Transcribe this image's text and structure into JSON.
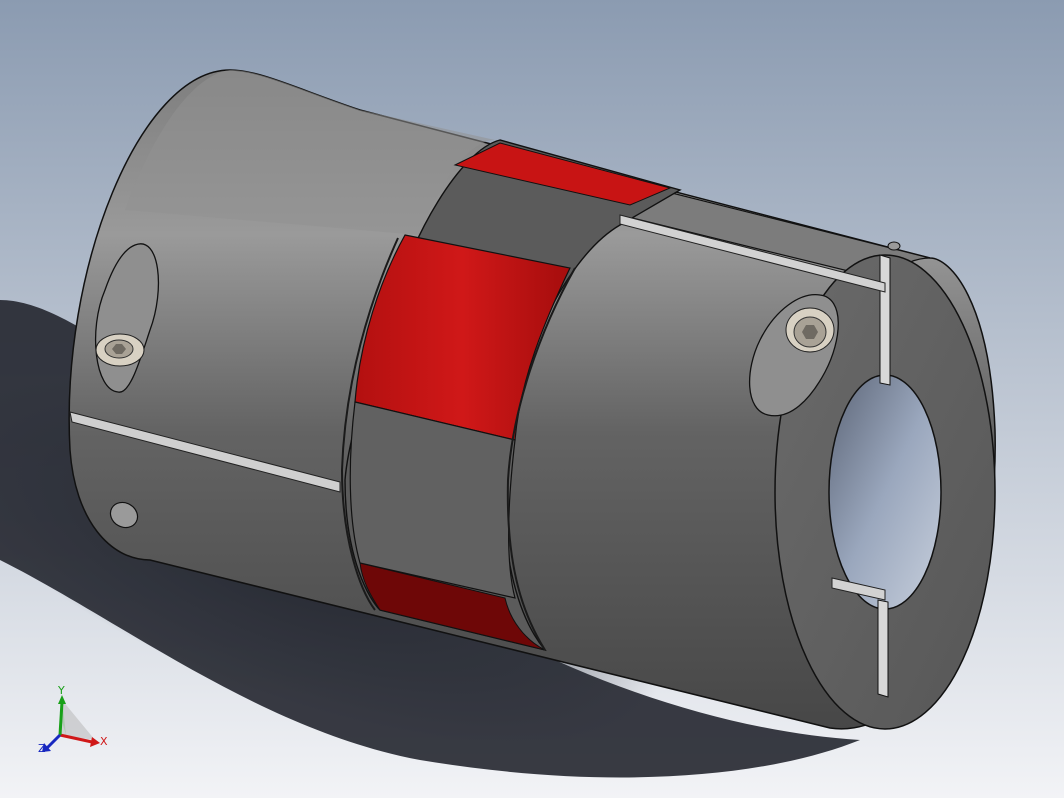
{
  "viewport": {
    "background_top": "#8b9bb1",
    "background_bottom": "#f2f3f6",
    "shadow_color": "#1c1f27"
  },
  "model": {
    "hub_color": "#5f5f5f",
    "hub_highlight": "#8a8a8a",
    "hub_dark": "#3c3c3c",
    "spider_color": "#c81414",
    "spider_dark": "#6e0707",
    "bore_color": "#8e9cb5"
  },
  "triad": {
    "x_label": "X",
    "y_label": "Y",
    "z_label": "Z",
    "x_color": "#d01818",
    "y_color": "#18a018",
    "z_color": "#1828c0"
  }
}
